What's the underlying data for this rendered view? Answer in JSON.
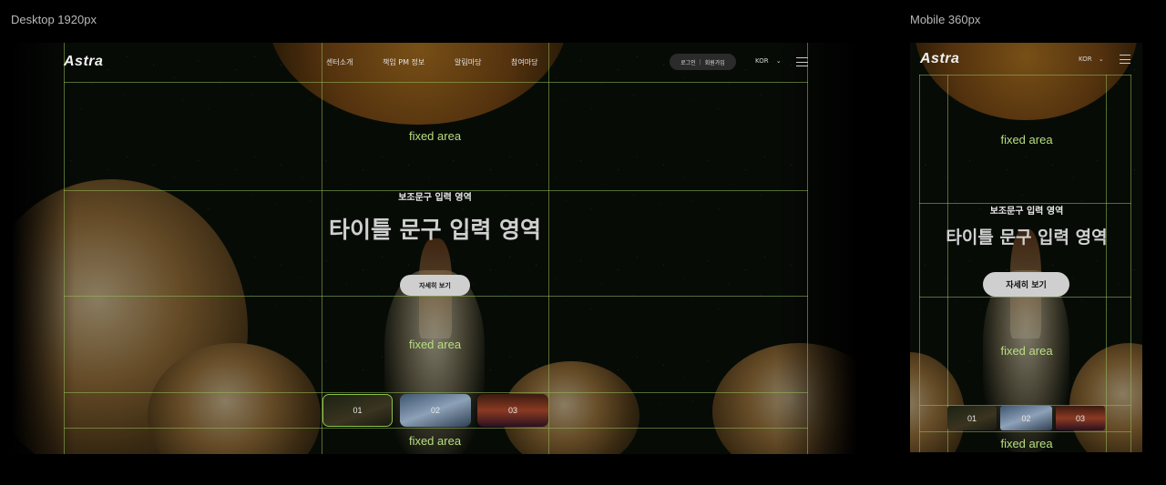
{
  "labels": {
    "desktop": "Desktop 1920px",
    "mobile": "Mobile 360px"
  },
  "logo": "Astra",
  "nav": {
    "items": [
      "센터소개",
      "책임 PM 정보",
      "알림마당",
      "참여마당"
    ]
  },
  "auth": {
    "login": "로그인",
    "separator": "|",
    "signup": "회원가입"
  },
  "lang": {
    "value": "KOR",
    "arrow": "⌄"
  },
  "hero": {
    "subtitle": "보조문구 입력 영역",
    "title": "타이틀 문구 입력 영역",
    "button": "자세히 보기"
  },
  "fixed_area_label": "fixed area",
  "thumbnails": [
    {
      "label": "01",
      "active": true
    },
    {
      "label": "02",
      "active": false
    },
    {
      "label": "03",
      "active": false
    }
  ],
  "colors": {
    "guide": "#96be5a",
    "fixed_area_text": "#b8df80",
    "active_thumb_border": "#8bc34a"
  }
}
